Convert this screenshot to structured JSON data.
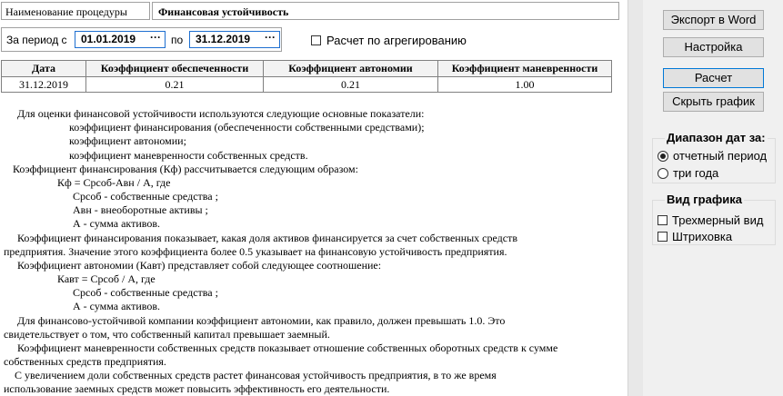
{
  "procedure": {
    "label": "Наименование процедуры",
    "value": "Финансовая устойчивость"
  },
  "period": {
    "label": "За период с",
    "from": "01.01.2019",
    "to_label": "по",
    "to": "31.12.2019",
    "picker_glyph": "···"
  },
  "aggregation": {
    "label": "Расчет по агрегированию",
    "checked": false
  },
  "table": {
    "headers": [
      "Дата",
      "Коэффициент обеспеченности",
      "Коэффициент автономии",
      "Коэффициент маневренности"
    ],
    "rows": [
      [
        "31.12.2019",
        "0.21",
        "0.21",
        "1.00"
      ]
    ]
  },
  "description": [
    "Для оценки финансовой устойчивости используются следующие основные показатели:",
    "коэффициент финансирования (обеспеченности собственными средствами);",
    "коэффициент автономии;",
    "коэффициент маневренности собственных средств.",
    "Коэффициент финансирования (Кф) рассчитывается следующим образом:",
    "Кф = Срсоб-Авн / А, где",
    "Срсоб - собственные средства ;",
    "Авн - внеоборотные активы ;",
    "А - сумма активов.",
    "Коэффициент финансирования показывает, какая доля активов финансируется за счет собственных средств",
    "предприятия. Значение этого коэффициента более 0.5 указывает на финансовую устойчивость предприятия.",
    "Коэффициент автономии (Кавт) представляет собой следующее соотношение:",
    "Кавт = Срсоб / А, где",
    "Срсоб - собственные средства ;",
    "А - сумма активов.",
    "Для финансово-устойчивой компании коэффициент автономии, как правило, должен превышать 1.0. Это",
    "свидетельствует о том, что  собственный капитал превышает заемный.",
    "Коэффициент маневренности собственных средств показывает отношение собственных оборотных средств к сумме",
    "собственных средств предприятия.",
    "С увеличением доли собственных средств растет финансовая устойчивость предприятия, в то же время",
    "использование заемных средств может повысить эффективность его деятельности."
  ],
  "buttons": {
    "export_word": "Экспорт в Word",
    "settings": "Настройка",
    "calculate": "Расчет",
    "hide_chart": "Скрыть график"
  },
  "date_range": {
    "title": "Диапазон дат за:",
    "options": [
      "отчетный период",
      "три года"
    ],
    "selected": "отчетный период"
  },
  "chart_view": {
    "title": "Вид графика",
    "options": [
      {
        "label": "Трехмерный вид",
        "checked": false
      },
      {
        "label": "Штриховка",
        "checked": false
      }
    ]
  }
}
